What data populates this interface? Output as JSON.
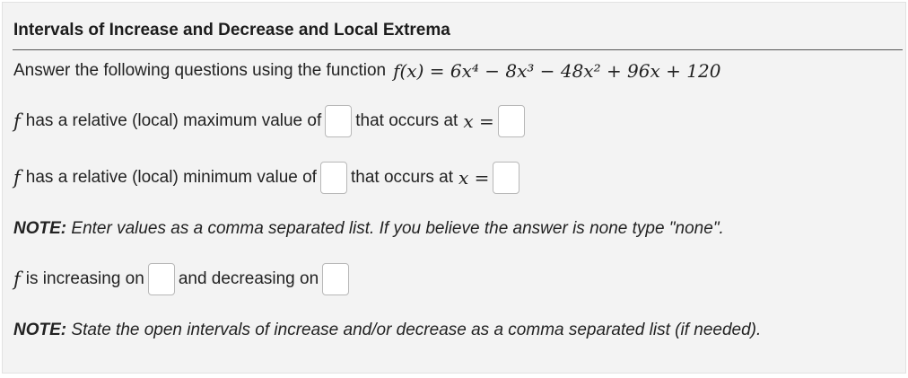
{
  "title": "Intervals of Increase and Decrease and Local Extrema",
  "intro": {
    "text": "Answer the following questions using the function",
    "function": "f(x) = 6x⁴ − 8x³ − 48x² + 96x + 120"
  },
  "max_line": {
    "f": "f",
    "text": "has a relative (local) maximum value of",
    "occurs": "that occurs at",
    "xeq": "x ="
  },
  "min_line": {
    "f": "f",
    "text": "has a relative (local) minimum value of",
    "occurs": "that occurs at",
    "xeq": "x ="
  },
  "note1": {
    "label": "NOTE:",
    "text": "Enter values as a comma separated list. If you believe the answer is none type \"none\"."
  },
  "incdec_line": {
    "f": "f",
    "increasing": "is increasing on",
    "decreasing": "and decreasing on"
  },
  "note2": {
    "label": "NOTE:",
    "text": "State the open intervals of increase and/or decrease as a comma separated list (if needed)."
  },
  "inputs": {
    "max_value": "",
    "max_x": "",
    "min_value": "",
    "min_x": "",
    "increasing": "",
    "decreasing": ""
  }
}
